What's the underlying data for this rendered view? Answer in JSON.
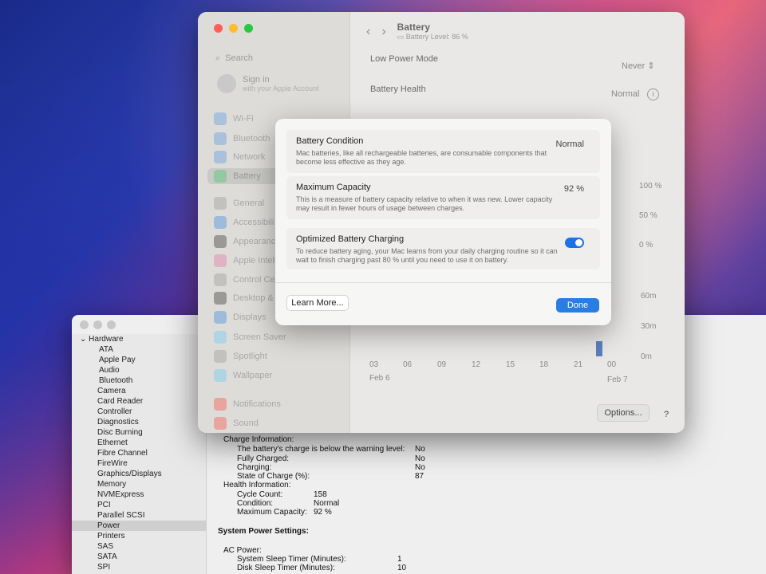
{
  "settings": {
    "title": "Battery",
    "subtitle": "Battery Level: 86 %",
    "search_placeholder": "Search",
    "signin_title": "Sign in",
    "signin_sub": "with your Apple Account",
    "nav": [
      {
        "label": "Wi-Fi",
        "icon": "wifi-icon",
        "color": "#4a90e2"
      },
      {
        "label": "Bluetooth",
        "icon": "bluetooth-icon",
        "color": "#4a90e2"
      },
      {
        "label": "Network",
        "icon": "network-icon",
        "color": "#4a90e2"
      },
      {
        "label": "Battery",
        "icon": "battery-icon",
        "color": "#34c759"
      },
      {
        "label": "General",
        "icon": "gear-icon",
        "color": "#8e8e93"
      },
      {
        "label": "Accessibili",
        "icon": "accessibility-icon",
        "color": "#2a7de1"
      },
      {
        "label": "Appearanc",
        "icon": "appearance-icon",
        "color": "#1c1c1e"
      },
      {
        "label": "Apple Intell",
        "icon": "apple-intelligence-icon",
        "color": "#e0669a"
      },
      {
        "label": "Control Ce",
        "icon": "control-center-icon",
        "color": "#8e8e93"
      },
      {
        "label": "Desktop &",
        "icon": "desktop-dock-icon",
        "color": "#1c1c1e"
      },
      {
        "label": "Displays",
        "icon": "display-icon",
        "color": "#2a7de1"
      },
      {
        "label": "Screen Saver",
        "icon": "screen-saver-icon",
        "color": "#5ac8fa"
      },
      {
        "label": "Spotlight",
        "icon": "spotlight-icon",
        "color": "#8e8e93"
      },
      {
        "label": "Wallpaper",
        "icon": "wallpaper-icon",
        "color": "#5ac8fa"
      },
      {
        "label": "Notifications",
        "icon": "notifications-icon",
        "color": "#ff3b30"
      },
      {
        "label": "Sound",
        "icon": "sound-icon",
        "color": "#ff3b30"
      }
    ],
    "low_power_label": "Low Power Mode",
    "low_power_value": "Never",
    "battery_health_label": "Battery Health",
    "battery_health_value": "Normal",
    "chart_y_labels": [
      "100 %",
      "50 %",
      "0 %"
    ],
    "chart_y2_labels": [
      "60m",
      "30m",
      "0m"
    ],
    "chart_x_labels": [
      "03",
      "06",
      "09",
      "12",
      "15",
      "18",
      "21",
      "00"
    ],
    "chart_date_left": "Feb 6",
    "chart_date_right": "Feb 7",
    "options_label": "Options...",
    "help_label": "?"
  },
  "dialog": {
    "condition_title": "Battery Condition",
    "condition_desc": "Mac batteries, like all rechargeable batteries, are consumable components that become less effective as they age.",
    "condition_value": "Normal",
    "capacity_title": "Maximum Capacity",
    "capacity_desc": "This is a measure of battery capacity relative to when it was new. Lower capacity may result in fewer hours of usage between charges.",
    "capacity_value": "92 %",
    "optimized_title": "Optimized Battery Charging",
    "optimized_desc": "To reduce battery aging, your Mac learns from your daily charging routine so it can wait to finish charging past 80 % until you need to use it on battery.",
    "optimized_enabled": true,
    "learn_more": "Learn More...",
    "done": "Done"
  },
  "sysinfo": {
    "group": "Hardware",
    "items": [
      "ATA",
      "Apple Pay",
      "Audio",
      "Bluetooth",
      "Camera",
      "Card Reader",
      "Controller",
      "Diagnostics",
      "Disc Burning",
      "Ethernet",
      "Fibre Channel",
      "FireWire",
      "Graphics/Displays",
      "Memory",
      "NVMExpress",
      "PCI",
      "Parallel SCSI",
      "Power",
      "Printers",
      "SAS",
      "SATA",
      "SPI"
    ],
    "selected": "Power",
    "charge_info": "Charge Information:",
    "warning_label": "The battery's charge is below the warning level:",
    "warning_value": "No",
    "fully_label": "Fully Charged:",
    "fully_value": "No",
    "charging_label": "Charging:",
    "charging_value": "No",
    "soc_label": "State of Charge (%):",
    "soc_value": "87",
    "health_info": "Health Information:",
    "cycle_label": "Cycle Count:",
    "cycle_value": "158",
    "cond_label": "Condition:",
    "cond_value": "Normal",
    "maxcap_label": "Maximum Capacity:",
    "maxcap_value": "92 %",
    "sps_title": "System Power Settings:",
    "ac_power": "AC Power:",
    "sleep_label": "System Sleep Timer (Minutes):",
    "sleep_value": "1",
    "disk_label": "Disk Sleep Timer (Minutes):",
    "disk_value": "10"
  }
}
